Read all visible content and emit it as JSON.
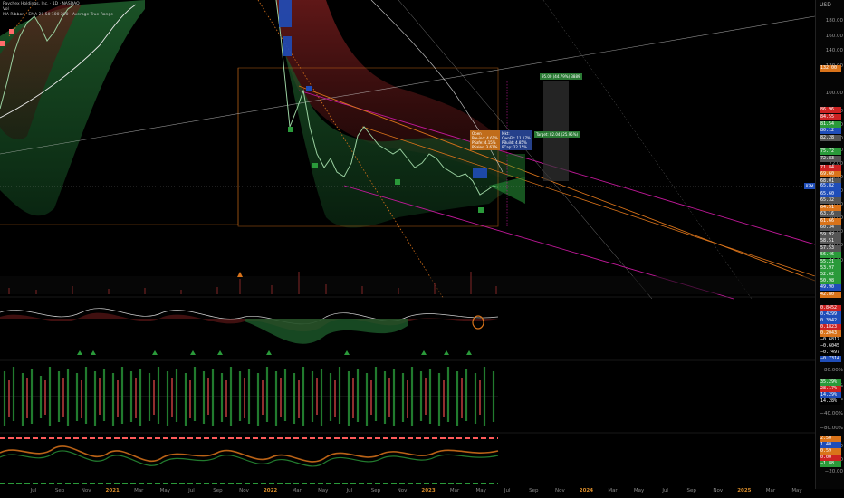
{
  "header": {
    "symbol_line": "Paychex Holdings, Inc. · 1D · NASDAQ",
    "sub_line": "Vol",
    "indicator_line": "MA Ribbon · EMA 20 50 100 200 · Average True Range"
  },
  "currency": "USD",
  "price_axis": [
    "180.00",
    "160.00",
    "140.00",
    "120.00",
    "100.00",
    "88.00",
    "84.00",
    "80.00",
    "76.00",
    "72.00",
    "68.00",
    "64.00",
    "60.00",
    "56.00",
    "52.00",
    "48.00",
    "44.00"
  ],
  "price_boxes": [
    {
      "v": "132.00",
      "c": "#d9731a"
    },
    {
      "v": "86.96",
      "c": "#cc2222"
    },
    {
      "v": "84.55",
      "c": "#cc2222"
    },
    {
      "v": "81.54",
      "c": "#2a9a3a"
    },
    {
      "v": "80.12",
      "c": "#1f4db8"
    },
    {
      "v": "82.28",
      "c": "#555"
    },
    {
      "v": "75.72",
      "c": "#2a9a3a"
    },
    {
      "v": "72.83",
      "c": "#555"
    },
    {
      "v": "71.84",
      "c": "#cc2222"
    },
    {
      "v": "69.60",
      "c": "#d9731a"
    },
    {
      "v": "68.01",
      "c": "#555"
    },
    {
      "v": "67.89",
      "c": "#1f4db8"
    },
    {
      "v": "65.60",
      "c": "#1f4db8"
    },
    {
      "v": "65.32",
      "c": "#555"
    },
    {
      "v": "64.51",
      "c": "#d9731a"
    },
    {
      "v": "63.16",
      "c": "#555"
    },
    {
      "v": "61.66",
      "c": "#d9731a"
    },
    {
      "v": "60.34",
      "c": "#555"
    },
    {
      "v": "59.92",
      "c": "#555"
    },
    {
      "v": "58.51",
      "c": "#555"
    },
    {
      "v": "57.53",
      "c": "#555"
    },
    {
      "v": "56.46",
      "c": "#2a9a3a"
    },
    {
      "v": "55.21",
      "c": "#2a9a3a"
    },
    {
      "v": "53.97",
      "c": "#2a9a3a"
    },
    {
      "v": "52.62",
      "c": "#2a9a3a"
    },
    {
      "v": "50.98",
      "c": "#2a9a3a"
    },
    {
      "v": "49.90",
      "c": "#1f4db8"
    },
    {
      "v": "42.80",
      "c": "#d9731a"
    }
  ],
  "last_price_box": "P3M",
  "last_price": "65.82",
  "osc1_boxes": [
    {
      "v": "0.8452",
      "c": "#cc2222"
    },
    {
      "v": "0.4299",
      "c": "#1f4db8"
    },
    {
      "v": "0.3942",
      "c": "#1f4db8"
    },
    {
      "v": "0.1823",
      "c": "#cc2222"
    },
    {
      "v": "0.2043",
      "c": "#d9731a"
    },
    {
      "v": "−0.6817",
      "c": "#000"
    },
    {
      "v": "−0.6045",
      "c": "#000"
    },
    {
      "v": "−0.7497",
      "c": "#000"
    },
    {
      "v": "−0.7314",
      "c": "#1f4db8"
    }
  ],
  "osc2_axis": [
    "80.00%",
    "40.00%",
    "0.00%",
    "−40.00%",
    "−80.00%"
  ],
  "osc2_boxes": [
    {
      "v": "35.29%",
      "c": "#2a9a3a"
    },
    {
      "v": "28.17%",
      "c": "#cc2222"
    },
    {
      "v": "14.29%",
      "c": "#1f4db8"
    },
    {
      "v": "14.28%",
      "c": "#000"
    }
  ],
  "osc3_axis": [
    "20.00",
    "0.00",
    "−20.00"
  ],
  "osc3_boxes": [
    {
      "v": "2.50",
      "c": "#d9731a"
    },
    {
      "v": "1.40",
      "c": "#1f4db8"
    },
    {
      "v": "0.59",
      "c": "#d9731a"
    },
    {
      "v": "0.00",
      "c": "#cc2222"
    },
    {
      "v": "−1.88",
      "c": "#2a9a3a"
    }
  ],
  "time_axis": [
    {
      "t": "Jul",
      "b": false
    },
    {
      "t": "Sep",
      "b": false
    },
    {
      "t": "Nov",
      "b": false
    },
    {
      "t": "2021",
      "b": true
    },
    {
      "t": "Mar",
      "b": false
    },
    {
      "t": "May",
      "b": false
    },
    {
      "t": "Jul",
      "b": false
    },
    {
      "t": "Sep",
      "b": false
    },
    {
      "t": "Nov",
      "b": false
    },
    {
      "t": "2022",
      "b": true
    },
    {
      "t": "Mar",
      "b": false
    },
    {
      "t": "May",
      "b": false
    },
    {
      "t": "Jul",
      "b": false
    },
    {
      "t": "Sep",
      "b": false
    },
    {
      "t": "Nov",
      "b": false
    },
    {
      "t": "2023",
      "b": true
    },
    {
      "t": "Mar",
      "b": false
    },
    {
      "t": "May",
      "b": false
    },
    {
      "t": "Jul",
      "b": false
    },
    {
      "t": "Sep",
      "b": false
    },
    {
      "t": "Nov",
      "b": false
    },
    {
      "t": "2024",
      "b": true
    },
    {
      "t": "Mar",
      "b": false
    },
    {
      "t": "May",
      "b": false
    },
    {
      "t": "Jul",
      "b": false
    },
    {
      "t": "Sep",
      "b": false
    },
    {
      "t": "Nov",
      "b": false
    },
    {
      "t": "2025",
      "b": true
    },
    {
      "t": "Mar",
      "b": false
    },
    {
      "t": "May",
      "b": false
    }
  ],
  "annotations": {
    "long_target": "95.00 (44.79%) 3889",
    "short_target": "Target: 82.04 (25.95%)",
    "stats_box_1": "Open\nPre-inc: 4.61%\nPSafe: 4.15%\nPSales: 3.61%",
    "stats_box_2": "Mkt:\nOwnFlt: 11.17%\nPBuild: 4.85%\nPCap: 22.15%"
  },
  "colors": {
    "bull": "#2a9a3a",
    "bear": "#cc2222",
    "accent": "#d9731a",
    "blue": "#1f4db8",
    "magenta": "#c2189a"
  }
}
